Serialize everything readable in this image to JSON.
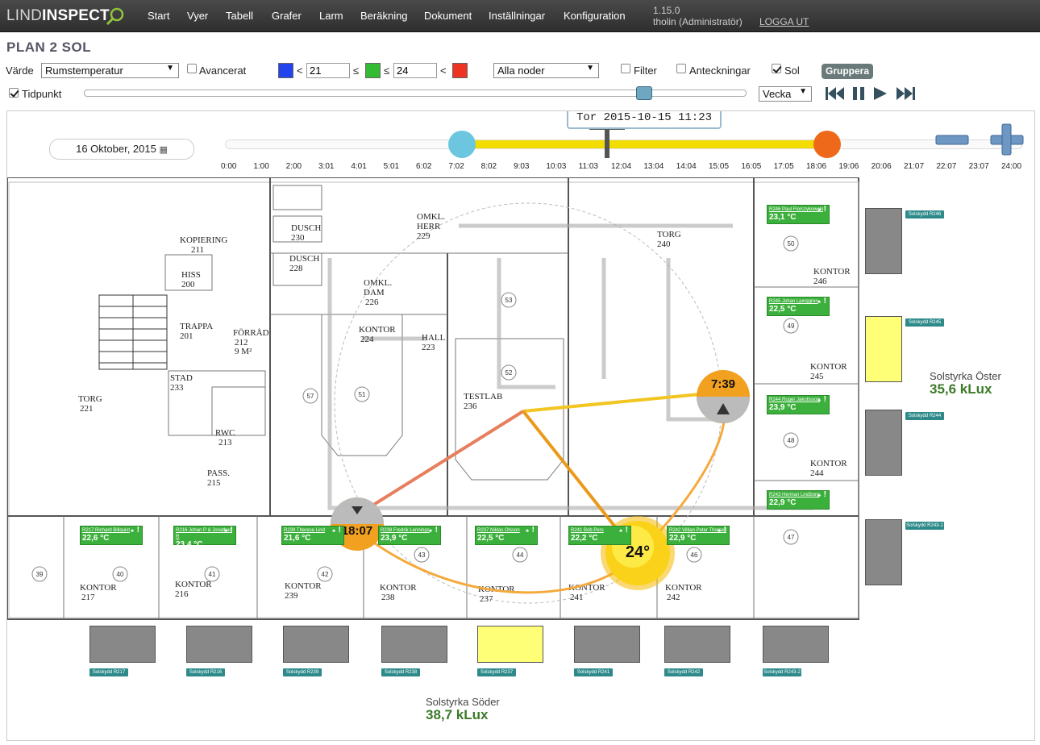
{
  "app": {
    "logo_part1": "LIND",
    "logo_part2": "INSPECT",
    "version": "1.15.0",
    "user": "tholin (Administratör)",
    "logout": "LOGGA UT"
  },
  "nav": [
    "Start",
    "Vyer",
    "Tabell",
    "Grafer",
    "Larm",
    "Beräkning",
    "Dokument",
    "Inställningar",
    "Konfiguration"
  ],
  "page_title": "PLAN 2 SOL",
  "controls": {
    "value_label": "Värde",
    "value_selected": "Rumstemperatur",
    "advanced_label": "Avancerat",
    "low_threshold": "21",
    "high_threshold": "24",
    "lt": "<",
    "le1": "≤",
    "le2": "≤",
    "lt2": "<",
    "nodes_selected": "Alla noder",
    "filter_label": "Filter",
    "notes_label": "Anteckningar",
    "sun_label": "Sol",
    "group_button": "Gruppera",
    "timepoint_label": "Tidpunkt",
    "period_selected": "Vecka",
    "colors": {
      "low": "#2244ee",
      "ok": "#33bb33",
      "high": "#ee3322"
    }
  },
  "timeline": {
    "date": "16 Oktober, 2015",
    "tooltip": "Tor 2015-10-15 11:23",
    "ticks": [
      "0:00",
      "1:00",
      "2:00",
      "3:01",
      "4:01",
      "5:01",
      "6:02",
      "7:02",
      "8:02",
      "9:03",
      "10:03",
      "11:03",
      "12:04",
      "13:04",
      "14:04",
      "15:05",
      "16:05",
      "17:05",
      "18:06",
      "19:06",
      "20:06",
      "21:07",
      "22:07",
      "23:07",
      "24:00"
    ]
  },
  "sun": {
    "sunrise": "7:39",
    "sunset": "18:07",
    "elevation": "24°"
  },
  "rooms": [
    {
      "label": "KOPIERING",
      "num": "211"
    },
    {
      "label": "HISS",
      "num": "200"
    },
    {
      "label": "TRAPPA",
      "num": "201"
    },
    {
      "label": "FÖRRÅD",
      "num": "212"
    },
    {
      "label": "STAD",
      "num": "233"
    },
    {
      "label": "TORG",
      "num": "221"
    },
    {
      "label": "RWC",
      "num": "213"
    },
    {
      "label": "PASS.",
      "num": "215"
    },
    {
      "label": "DUSCH",
      "num": "230"
    },
    {
      "label": "DUSCH",
      "num": "228"
    },
    {
      "label": "OMKL. DAM",
      "num": "226"
    },
    {
      "label": "KONTOR",
      "num": "224"
    },
    {
      "label": "OMKL. HERR",
      "num": "229"
    },
    {
      "label": "HALL",
      "num": "223"
    },
    {
      "label": "TESTLAB",
      "num": "236"
    },
    {
      "label": "TORG",
      "num": "240"
    },
    {
      "label": "KONTOR",
      "num": "246"
    },
    {
      "label": "KONTOR",
      "num": "245"
    },
    {
      "label": "KONTOR",
      "num": "244"
    },
    {
      "label": "KONTOR",
      "num": "217"
    },
    {
      "label": "KONTOR",
      "num": "216"
    },
    {
      "label": "KONTOR",
      "num": "239"
    },
    {
      "label": "KONTOR",
      "num": "238"
    },
    {
      "label": "KONTOR",
      "num": "237"
    },
    {
      "label": "KONTOR",
      "num": "241"
    },
    {
      "label": "KONTOR",
      "num": "242"
    }
  ],
  "sensors_east": [
    {
      "name": "R246 Paul Florczykowski",
      "temp": "23,1 °C"
    },
    {
      "name": "R245 Johan Ljunggren",
      "temp": "22,5 °C"
    },
    {
      "name": "R244 Roger Jakobsson",
      "temp": "23,9 °C"
    },
    {
      "name": "R243 Herman Lindborg",
      "temp": "22,9 °C"
    }
  ],
  "sensors_south": [
    {
      "name": "R217 Richard Billquist",
      "temp": "22,6 °C"
    },
    {
      "name": "R216 Johan P & Jonathan R",
      "temp": "23,4 °C"
    },
    {
      "name": "R239 Therese Lind",
      "temp": "21,6 °C"
    },
    {
      "name": "R238 Fredrik Lennings",
      "temp": "23,9 °C"
    },
    {
      "name": "R237 Niklas Olsson",
      "temp": "22,5 °C"
    },
    {
      "name": "R241 Bob Pers",
      "temp": "22,2 °C"
    },
    {
      "name": "R242 Villian Peter Thorsell",
      "temp": "22,9 °C"
    }
  ],
  "shades_east": [
    {
      "label": "Solskydd R246",
      "lit": false
    },
    {
      "label": "Solskydd R245",
      "lit": true
    },
    {
      "label": "Solskydd R244",
      "lit": false
    },
    {
      "label": "Solskydd R243-1",
      "lit": false
    }
  ],
  "shades_south": [
    {
      "label": "Solskydd R217",
      "lit": false
    },
    {
      "label": "Solskydd R216",
      "lit": false
    },
    {
      "label": "Solskydd R239",
      "lit": false
    },
    {
      "label": "Solskydd R238",
      "lit": false
    },
    {
      "label": "Solskydd R237",
      "lit": true
    },
    {
      "label": "Solskydd R241",
      "lit": false
    },
    {
      "label": "Solskydd R242",
      "lit": false
    },
    {
      "label": "Solskydd R243-2",
      "lit": false
    }
  ],
  "sun_strength_east": {
    "label": "Solstyrka Öster",
    "value": "35,6 kLux"
  },
  "sun_strength_south": {
    "label": "Solstyrka Söder",
    "value": "38,7 kLux"
  }
}
